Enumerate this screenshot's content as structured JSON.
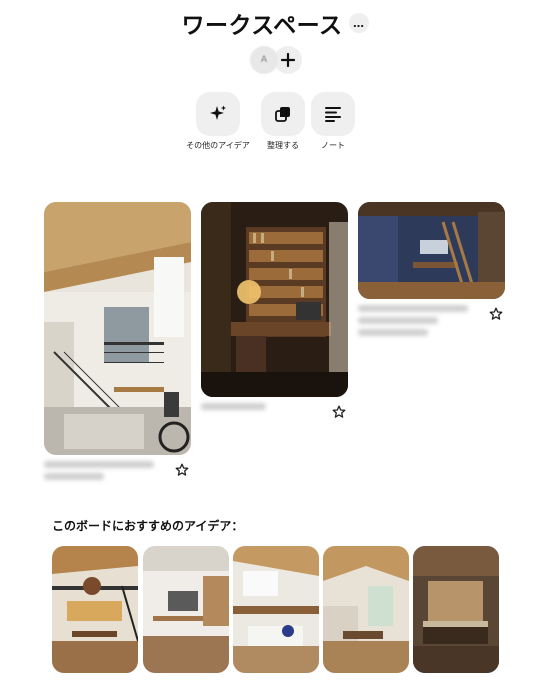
{
  "board": {
    "title": "ワークスペース",
    "more_label": "…",
    "collaborator_initial": "A"
  },
  "actions": [
    {
      "label": "その他のアイデア",
      "icon": "sparkle-icon"
    },
    {
      "label": "整理する",
      "icon": "organize-icon"
    },
    {
      "label": "ノート",
      "icon": "notes-icon"
    }
  ],
  "pins": [
    {
      "name": "pin-loft-stairs",
      "icon": "star-icon"
    },
    {
      "name": "pin-study-bookshelf",
      "icon": "star-icon"
    },
    {
      "name": "pin-blue-loft-room",
      "icon": "star-icon"
    }
  ],
  "recommendations": {
    "title": "このボードにおすすめのアイデア："
  },
  "colors": {
    "accent_bg": "#efefef",
    "text": "#111111"
  }
}
